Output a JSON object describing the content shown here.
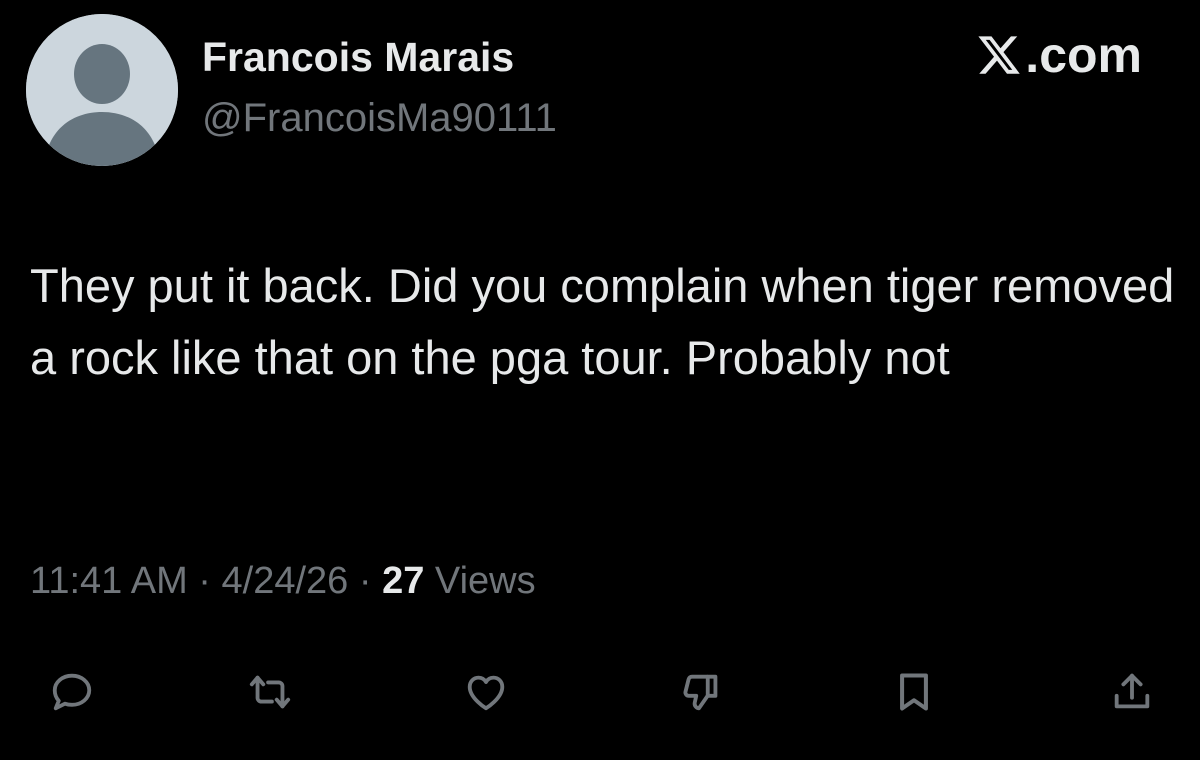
{
  "author": {
    "name": "Francois Marais",
    "handle": "@FrancoisMa90111",
    "avatar_icon": "default-avatar-icon",
    "avatar_color": "#ccd6dd"
  },
  "brand": {
    "logo_icon": "x-logo-icon",
    "suffix": ".com"
  },
  "tweet": {
    "text": "They put it back. Did you complain when tiger removed a rock like that on the pga tour. Probably not"
  },
  "meta": {
    "time": "11:41 AM",
    "separator_1": " · ",
    "date": "4/24/26",
    "separator_2": " · ",
    "views_count": "27",
    "views_label": " Views"
  },
  "actions": [
    {
      "icon": "reply-icon"
    },
    {
      "icon": "retweet-icon"
    },
    {
      "icon": "like-icon"
    },
    {
      "icon": "dislike-icon"
    },
    {
      "icon": "bookmark-icon"
    },
    {
      "icon": "share-icon"
    }
  ],
  "colors": {
    "background": "#000000",
    "primary_text": "#e7e9ea",
    "secondary_text": "#71767b",
    "icon_color": "#71767b"
  }
}
